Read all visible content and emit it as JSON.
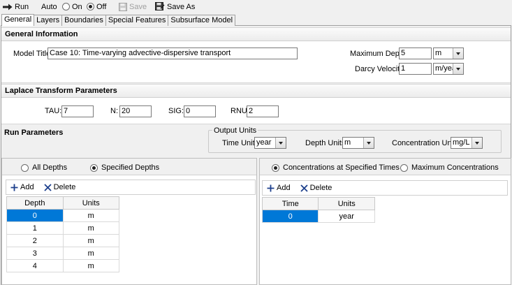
{
  "toolbar": {
    "run_label": "Run",
    "auto_label": "Auto",
    "on_label": "On",
    "off_label": "Off",
    "auto_selected": "off",
    "save_label": "Save",
    "save_as_label": "Save As"
  },
  "tabs": [
    {
      "label": "General",
      "active": true
    },
    {
      "label": "Layers",
      "active": false
    },
    {
      "label": "Boundaries",
      "active": false
    },
    {
      "label": "Special Features",
      "active": false
    },
    {
      "label": "Subsurface Model",
      "active": false
    }
  ],
  "general": {
    "header": "General Information",
    "model_title_label": "Model Title:",
    "model_title_value": "Case 10: Time-varying advective-dispersive transport",
    "max_depth_label": "Maximum Depth:",
    "max_depth_value": "5",
    "max_depth_unit": "m",
    "darcy_label": "Darcy Velocity:",
    "darcy_value": "1",
    "darcy_unit": "m/year"
  },
  "laplace": {
    "header": "Laplace Transform Parameters",
    "tau_label": "TAU:",
    "tau_value": "7",
    "n_label": "N:",
    "n_value": "20",
    "sig_label": "SIG:",
    "sig_value": "0",
    "rnu_label": "RNU:",
    "rnu_value": "2"
  },
  "run": {
    "header": "Run Parameters",
    "output_units_label": "Output Units",
    "time_units_label": "Time Units:",
    "time_units_value": "year",
    "depth_units_label": "Depth Units:",
    "depth_units_value": "m",
    "conc_units_label": "Concentration Units:",
    "conc_units_value": "mg/L"
  },
  "depth_pane": {
    "all_depths_label": "All Depths",
    "specified_depths_label": "Specified Depths",
    "selected": "specified",
    "add_label": "Add",
    "delete_label": "Delete",
    "columns": [
      "Depth",
      "Units"
    ],
    "rows": [
      {
        "value": "0",
        "unit": "m"
      },
      {
        "value": "1",
        "unit": "m"
      },
      {
        "value": "2",
        "unit": "m"
      },
      {
        "value": "3",
        "unit": "m"
      },
      {
        "value": "4",
        "unit": "m"
      }
    ]
  },
  "time_pane": {
    "specified_times_label": "Concentrations at Specified Times",
    "max_conc_label": "Maximum Concentrations",
    "selected": "specified",
    "add_label": "Add",
    "delete_label": "Delete",
    "columns": [
      "Time",
      "Units"
    ],
    "rows": [
      {
        "value": "0",
        "unit": "year"
      }
    ]
  },
  "colors": {
    "selection": "#0078d7",
    "add_icon": "#1c3f8c",
    "delete_icon": "#1c3f8c",
    "run_icon": "#222222"
  }
}
